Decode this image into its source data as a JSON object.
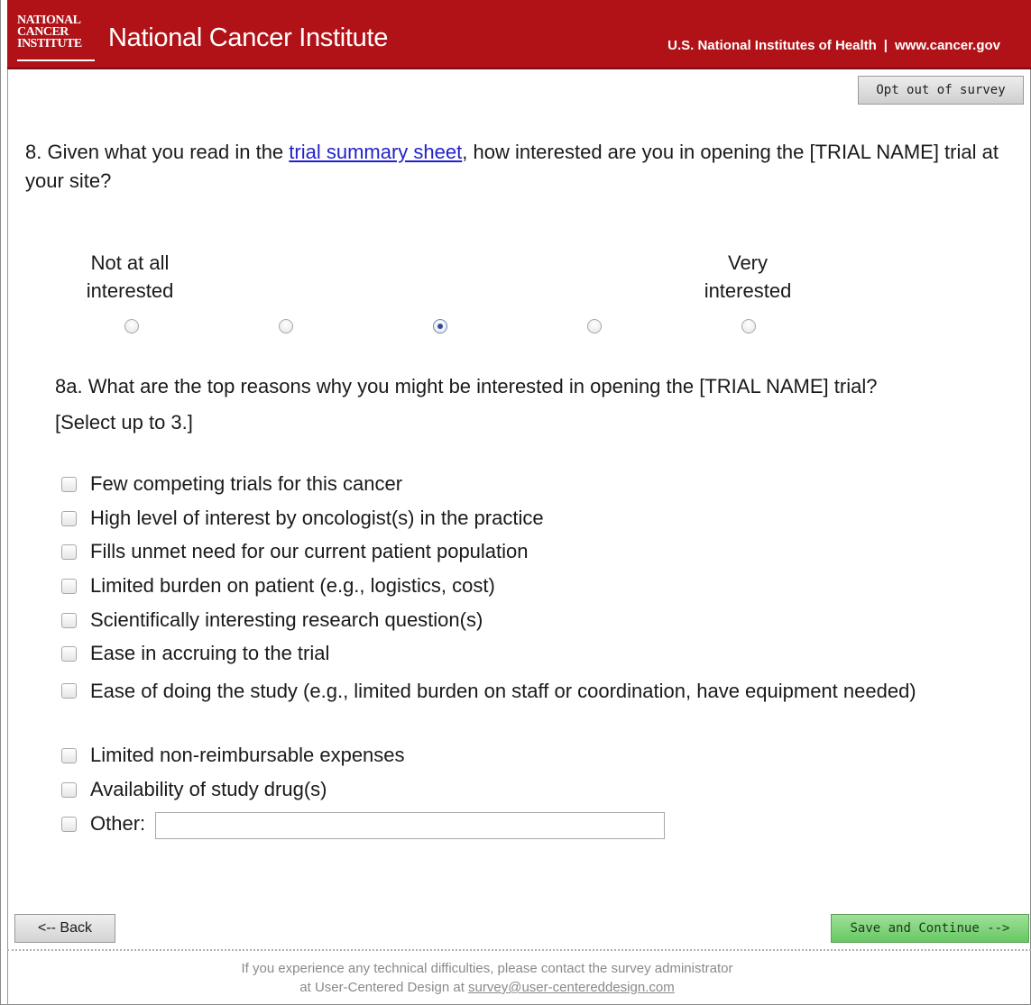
{
  "header": {
    "logo_lines": [
      "NATIONAL",
      "CANCER",
      "INSTITUTE"
    ],
    "org_name": "National Cancer Institute",
    "nih_link": "U.S. National Institutes of Health",
    "separator": "|",
    "site_link": "www.cancer.gov",
    "brand_color": "#b01218"
  },
  "toolbar": {
    "opt_out_label": "Opt out of survey"
  },
  "question": {
    "prefix": "8. Given what you read in the ",
    "link_text": "trial summary sheet",
    "suffix": ", how interested are you in opening the [TRIAL NAME] trial at your site?"
  },
  "scale": {
    "low_label_line1": "Not at all",
    "low_label_line2": "interested",
    "high_label_line1": "Very",
    "high_label_line2": "interested",
    "options_count": 5,
    "selected_index": 2
  },
  "subquestion": {
    "text": "8a. What are the top reasons why you might be interested in opening the [TRIAL NAME] trial?",
    "instruction": "[Select up to 3.]"
  },
  "reasons": [
    "Few competing trials for this cancer",
    "High level of interest by oncologist(s) in the practice",
    "Fills unmet need for our current patient population",
    "Limited burden on patient (e.g., logistics, cost)",
    "Scientifically interesting research question(s)",
    "Ease in accruing to the trial",
    "Ease of doing the study (e.g., limited burden on staff or coordination, have equipment needed)",
    "Limited non-reimbursable expenses",
    "Availability of study drug(s)",
    "Other:"
  ],
  "other_input_value": "",
  "nav": {
    "back_label": "<-- Back",
    "save_label": "Save and Continue -->"
  },
  "footer": {
    "line1": "If you experience any technical difficulties, please contact the survey administrator",
    "line2_prefix": "at User-Centered Design at ",
    "email": "survey@user-centereddesign.com"
  }
}
